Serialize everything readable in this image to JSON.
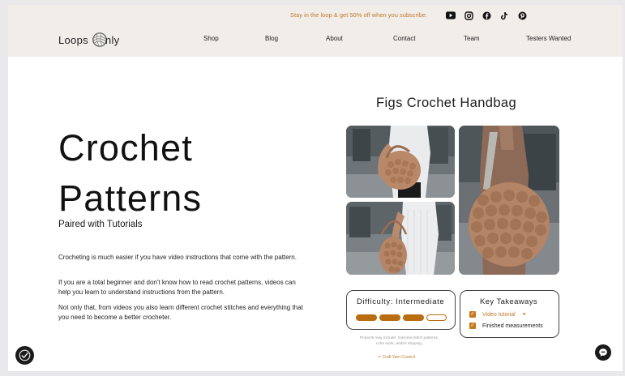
{
  "promo": {
    "text": "Stay in the loop & get 50% off when you subscribe."
  },
  "social": [
    {
      "icon": "youtube-icon"
    },
    {
      "icon": "instagram-icon"
    },
    {
      "icon": "facebook-icon"
    },
    {
      "icon": "tiktok-icon"
    },
    {
      "icon": "pinterest-icon"
    }
  ],
  "logo": {
    "left": "Loops",
    "right": "nly"
  },
  "nav": [
    "Shop",
    "Blog",
    "About",
    "Contact",
    "Team",
    "Testers Wanted"
  ],
  "hero": {
    "title_line1": "Crochet",
    "title_line2": "Patterns",
    "subtitle": "Paired with Tutorials",
    "paragraphs": [
      "Crocheting is much easier if you have video instructions that come with the pattern.",
      "If you are a total beginner and don't know how to read crochet patterns, videos can help you learn to understand instructions from the pattern.",
      "Not only that, from videos you also learn different crochet stitches and everything that you need to become a better crocheter."
    ]
  },
  "product": {
    "title": "Figs Crochet Handbag",
    "difficulty": {
      "label": "Difficulty: Intermediate",
      "level": 3,
      "max": 4
    },
    "key_takeaways": {
      "label": "Key Takeaways",
      "items": [
        "Video tutorial",
        "Finished measurements"
      ]
    },
    "note": "Projects may include: mirrored stitch patterns, color work, and/or shaping.",
    "yarn_link": "Craft Yarn Council"
  },
  "colors": {
    "accent": "#c27a2c",
    "difficulty_fill": "#b96d10",
    "topbar": "#f1eee9"
  }
}
